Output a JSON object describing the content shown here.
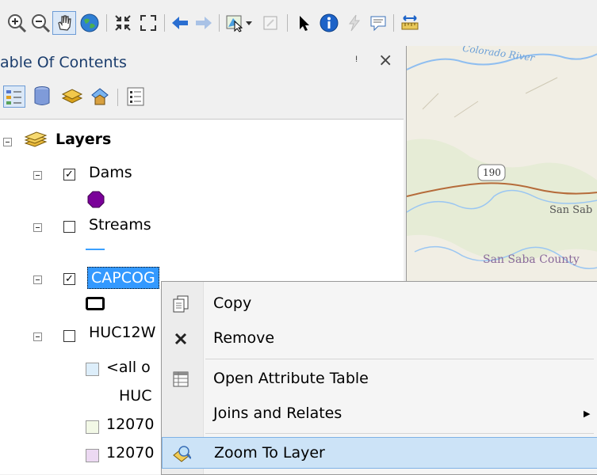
{
  "toc": {
    "title": "able Of Contents",
    "pin_glyph": "ᵎ",
    "close_glyph": "×",
    "tools": [
      "list-by-drawing-order-icon",
      "list-by-source-icon",
      "list-by-visibility-icon",
      "list-by-selection-icon",
      "options-icon"
    ]
  },
  "layers": {
    "root_label": "Layers",
    "items": [
      {
        "name": "Dams",
        "checked": true,
        "symbol_color": "#7a0099"
      },
      {
        "name": "Streams",
        "checked": false,
        "symbol_color": "#3aa0ff"
      },
      {
        "name": "CAPCOG",
        "checked": true,
        "selected": true
      },
      {
        "name": "HUC12W",
        "checked": false
      },
      {
        "legend": "<all o"
      },
      {
        "legend": "HUC"
      },
      {
        "legend": "12070",
        "color": "#f2f8e6"
      },
      {
        "legend": "12070",
        "color": "#ecd9f2"
      }
    ]
  },
  "map": {
    "labels": [
      "Colorado River",
      "190",
      "San Sab",
      "San Saba County"
    ]
  },
  "menu": {
    "items": [
      {
        "label": "Copy",
        "icon": "copy-icon"
      },
      {
        "label": "Remove",
        "icon": "remove-icon"
      },
      {
        "label": "Open Attribute Table",
        "icon": "attribute-table-icon"
      },
      {
        "label": "Joins and Relates",
        "submenu_arrow": "▶"
      },
      {
        "label": "Zoom To Layer",
        "icon": "zoom-to-layer-icon",
        "highlighted": true
      }
    ]
  },
  "colors": {
    "accent": "#3399ff",
    "selection": "#cce3f7"
  }
}
